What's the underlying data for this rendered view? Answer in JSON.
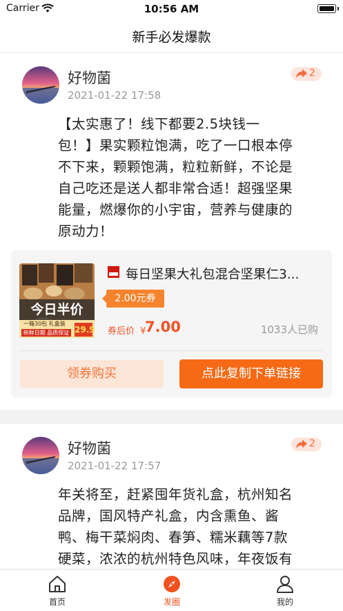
{
  "status_bar": {
    "carrier": "Carrier",
    "time": "10:56 AM"
  },
  "navbar": {
    "title": "新手必发爆款"
  },
  "posts": [
    {
      "author": "好物菌",
      "date": "2021-01-22 17:58",
      "share_count": "2",
      "lines": [
        "【太实惠了！线下都要2.5块钱一",
        "包！】果实颗粒饱满，吃了一口根本停",
        "不下来，颗颗饱满，粒粒新鲜，不论是",
        "自己吃还是送人都非常合适！超强坚果",
        "能量，燃爆你的小宇宙，营养与健康的",
        "原动力！"
      ],
      "product": {
        "thumb_banner": "今日半价",
        "thumb_line": "一箱30包 礼盒装",
        "thumb_red": "新鲜日期 品质保证",
        "thumb_price": "29.9",
        "title": "每日坚果大礼包混合坚果仁3...",
        "coupon": "2.00元券",
        "after_label": "券后价",
        "currency": "¥",
        "price": "7.00",
        "buyers": "1033人已购",
        "coupon_button": "领券购买",
        "copy_button": "点此复制下单链接"
      }
    },
    {
      "author": "好物菌",
      "date": "2021-01-22 17:57",
      "share_count": "2",
      "lines": [
        "年关将至，赶紧囤年货礼盒，杭州知名",
        "品牌，国风特产礼盒，内含熏鱼、酱",
        "鸭、梅干菜焖肉、春笋、糯米藕等7款",
        "硬菜，浓浓的杭州特色风味，年夜饭有"
      ]
    }
  ],
  "tabbar": {
    "items": [
      {
        "label": "首页",
        "icon": "home-icon"
      },
      {
        "label": "发圈",
        "icon": "compass-icon",
        "active": true
      },
      {
        "label": "我的",
        "icon": "user-icon"
      }
    ]
  },
  "colors": {
    "accent": "#f66a16",
    "price": "#ef5226",
    "badge_bg": "#fde4dc"
  }
}
